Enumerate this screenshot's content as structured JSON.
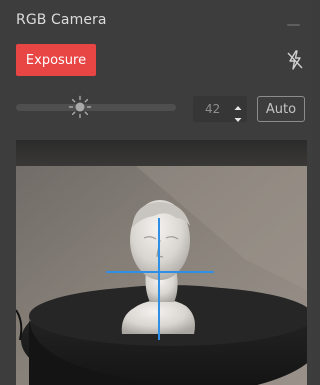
{
  "window": {
    "title": "RGB Camera"
  },
  "toolbar": {
    "exposure_label": "Exposure"
  },
  "exposure": {
    "slider_level": 0.4,
    "value": "42",
    "auto_label": "Auto"
  },
  "icons": {
    "minimize": "minimize-icon",
    "flash": "flash-off-icon",
    "brightness": "sun-icon",
    "spin_up": "chevron-up-icon",
    "spin_down": "chevron-down-icon"
  },
  "colors": {
    "accent": "#e84545",
    "crosshair": "#2d8fe6",
    "panel": "#3d3d3d"
  }
}
